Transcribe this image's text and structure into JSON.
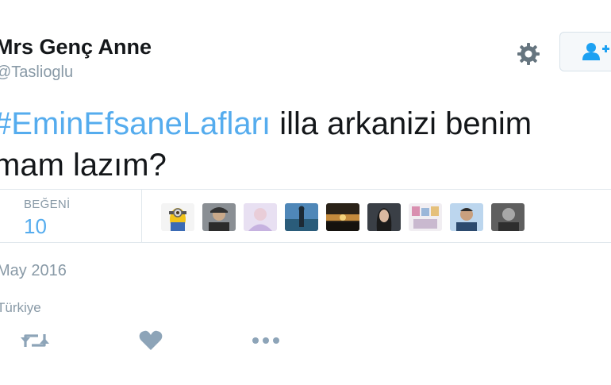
{
  "header": {
    "display_name": "Mrs Genç Anne",
    "handle": "@Taslioglu",
    "settings_icon": "gear-icon",
    "follow_icon": "follow-user-icon"
  },
  "tweet": {
    "hashtag": "#EminEfsaneLafları",
    "text_line1": " illa arkanizi benim",
    "text_line2": "mam lazım?"
  },
  "stats": {
    "likes_label": "BEĞENİ",
    "likes_count": "10",
    "liker_avatar_count": 9
  },
  "meta": {
    "date": "May 2016",
    "location": "Türkiye"
  },
  "actions": [
    {
      "icon": "retweet-icon"
    },
    {
      "icon": "heart-icon"
    },
    {
      "icon": "more-icon"
    }
  ],
  "colors": {
    "link": "#55acee",
    "muted": "#8899a6",
    "text": "#14171a",
    "border": "#e1e8ed"
  }
}
